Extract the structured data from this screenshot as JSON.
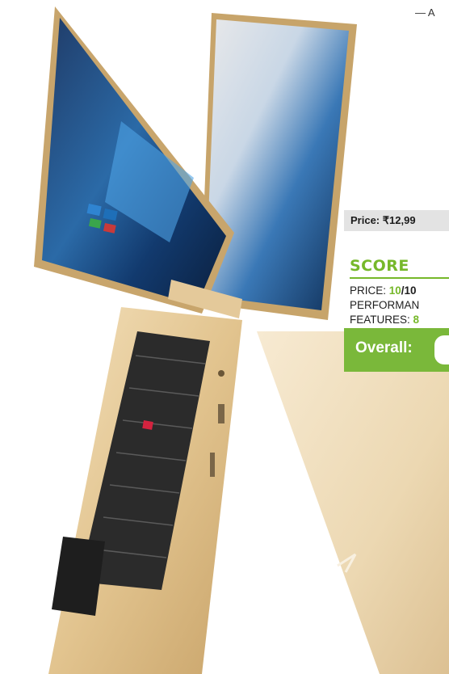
{
  "byline": "— A",
  "price": {
    "label": "Price:",
    "value": "₹12,99"
  },
  "score": {
    "title": "SCORE",
    "rows": [
      {
        "label": "PRICE: ",
        "value": "10",
        "sep": "/10"
      },
      {
        "label": "PERFORMAN",
        "value": "",
        "sep": ""
      },
      {
        "label": "FEATURES: ",
        "value": "8",
        "sep": ""
      }
    ]
  },
  "overall": {
    "label": "Overall:"
  },
  "colors": {
    "accent_green": "#7ab83a",
    "price_bg": "#e3e3e3",
    "laptop_gold": "#e8cf9f"
  }
}
